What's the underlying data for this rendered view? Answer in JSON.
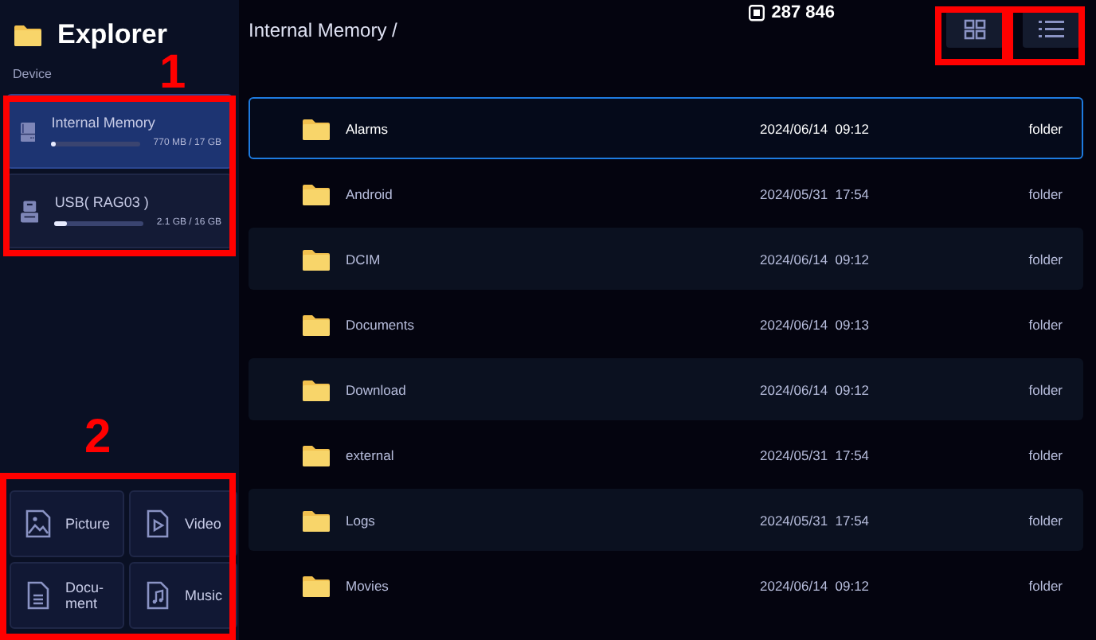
{
  "sidebar": {
    "title": "Explorer",
    "section_label": "Device",
    "storage": [
      {
        "name": "Internal Memory",
        "usage": "770 MB / 17 GB",
        "level": 0.05,
        "selected": true,
        "kind": "internal"
      },
      {
        "name": "USB( RAG03 )",
        "usage": "2.1 GB / 16 GB",
        "level": 0.13,
        "selected": false,
        "kind": "usb"
      }
    ],
    "categories": [
      {
        "label": "Picture",
        "kind": "picture"
      },
      {
        "label": "Video",
        "kind": "video"
      },
      {
        "label": "Docu-\nment",
        "kind": "document"
      },
      {
        "label": "Music",
        "kind": "music"
      }
    ]
  },
  "path": "Internal Memory /",
  "counter": "287 846",
  "view_buttons": [
    {
      "kind": "grid"
    },
    {
      "kind": "list"
    }
  ],
  "files": [
    {
      "name": "Alarms",
      "date": "2024/06/14  09:12",
      "type": "folder",
      "selected": true
    },
    {
      "name": "Android",
      "date": "2024/05/31  17:54",
      "type": "folder",
      "selected": false
    },
    {
      "name": "DCIM",
      "date": "2024/06/14  09:12",
      "type": "folder",
      "selected": false
    },
    {
      "name": "Documents",
      "date": "2024/06/14  09:13",
      "type": "folder",
      "selected": false
    },
    {
      "name": "Download",
      "date": "2024/06/14  09:12",
      "type": "folder",
      "selected": false
    },
    {
      "name": "external",
      "date": "2024/05/31  17:54",
      "type": "folder",
      "selected": false
    },
    {
      "name": "Logs",
      "date": "2024/05/31  17:54",
      "type": "folder",
      "selected": false
    },
    {
      "name": "Movies",
      "date": "2024/06/14  09:12",
      "type": "folder",
      "selected": false
    }
  ],
  "annotations": [
    {
      "label": "1",
      "kind": "storage"
    },
    {
      "label": "2",
      "kind": "categories"
    },
    {
      "kind": "gridbutton"
    },
    {
      "kind": "listbutton"
    }
  ]
}
